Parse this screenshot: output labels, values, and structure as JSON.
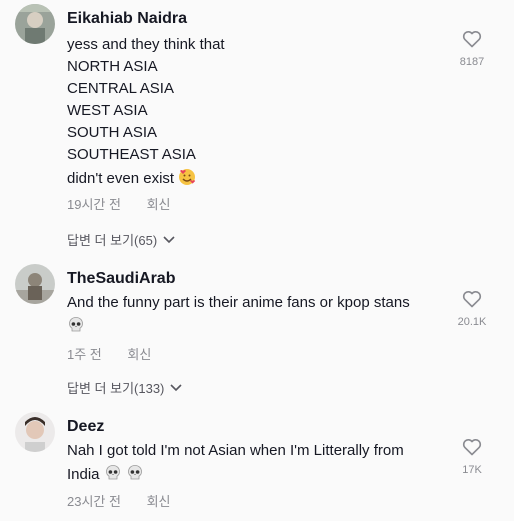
{
  "comments": [
    {
      "username": "Eikahiab Naidra",
      "lines": [
        "yess and they think that",
        "NORTH ASIA",
        "CENTRAL ASIA",
        "WEST ASIA",
        "SOUTH ASIA",
        "SOUTHEAST ASIA",
        "didn't even exist"
      ],
      "time": "19시간 전",
      "reply_label": "회신",
      "like_count": "8187",
      "view_replies": "답변 더 보기(65)",
      "emoji": "smiling-face-with-hearts"
    },
    {
      "username": "TheSaudiArab",
      "lines": [
        "And the funny part is their anime fans or kpop stans"
      ],
      "time": "1주 전",
      "reply_label": "회신",
      "like_count": "20.1K",
      "view_replies": "답변 더 보기(133)",
      "emoji": "skull"
    },
    {
      "username": "Deez",
      "lines": [
        "Nah I got told I'm not Asian when I'm Litterally from",
        "India"
      ],
      "time": "23시간 전",
      "reply_label": "회신",
      "like_count": "17K",
      "emoji": "skull"
    }
  ],
  "colors": {
    "text": "#161823",
    "meta": "#8a8b91",
    "background": "#fafafa"
  }
}
